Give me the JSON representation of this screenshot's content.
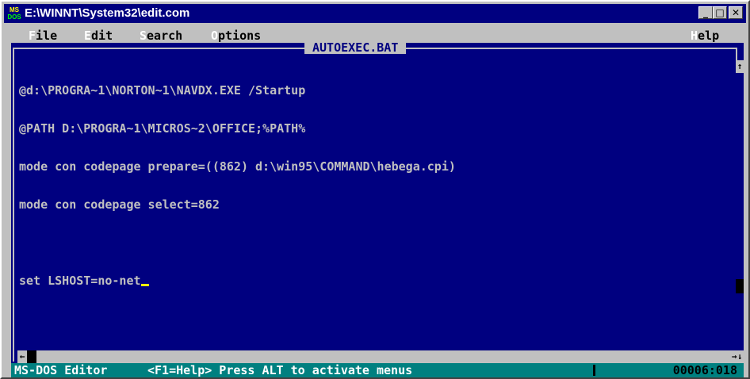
{
  "window": {
    "title": "E:\\WINNT\\System32\\edit.com",
    "icon_top": "MS",
    "icon_bottom": "DOS",
    "minimize_glyph": "_",
    "maximize_glyph": "□",
    "close_glyph": "✕"
  },
  "menu": {
    "file": {
      "hot": "F",
      "rest": "ile"
    },
    "edit": {
      "hot": "E",
      "rest": "dit"
    },
    "search": {
      "hot": "S",
      "rest": "earch"
    },
    "options": {
      "hot": "O",
      "rest": "ptions"
    },
    "help": {
      "hot": "H",
      "rest": "elp"
    }
  },
  "document": {
    "filename": "AUTOEXEC.BAT",
    "lines": [
      "@d:\\PROGRA~1\\NORTON~1\\NAVDX.EXE /Startup",
      "@PATH D:\\PROGRA~1\\MICROS~2\\OFFICE;%PATH%",
      "mode con codepage prepare=((862) d:\\win95\\COMMAND\\hebega.cpi)",
      "mode con codepage select=862",
      "",
      "set LSHOST=no-net"
    ]
  },
  "scrollbars": {
    "up_arrow": "↑",
    "down_arrow": "↓",
    "left_arrow": "←",
    "right_arrow": "→"
  },
  "status": {
    "app": "MS-DOS Editor",
    "help": "<F1=Help> Press ALT to activate menus",
    "position": "00006:018"
  },
  "colors": {
    "titlebar": "#000080",
    "editor_bg": "#000080",
    "editor_text": "#c0c0c0",
    "statusbar": "#008080",
    "chrome": "#c0c0c0"
  }
}
